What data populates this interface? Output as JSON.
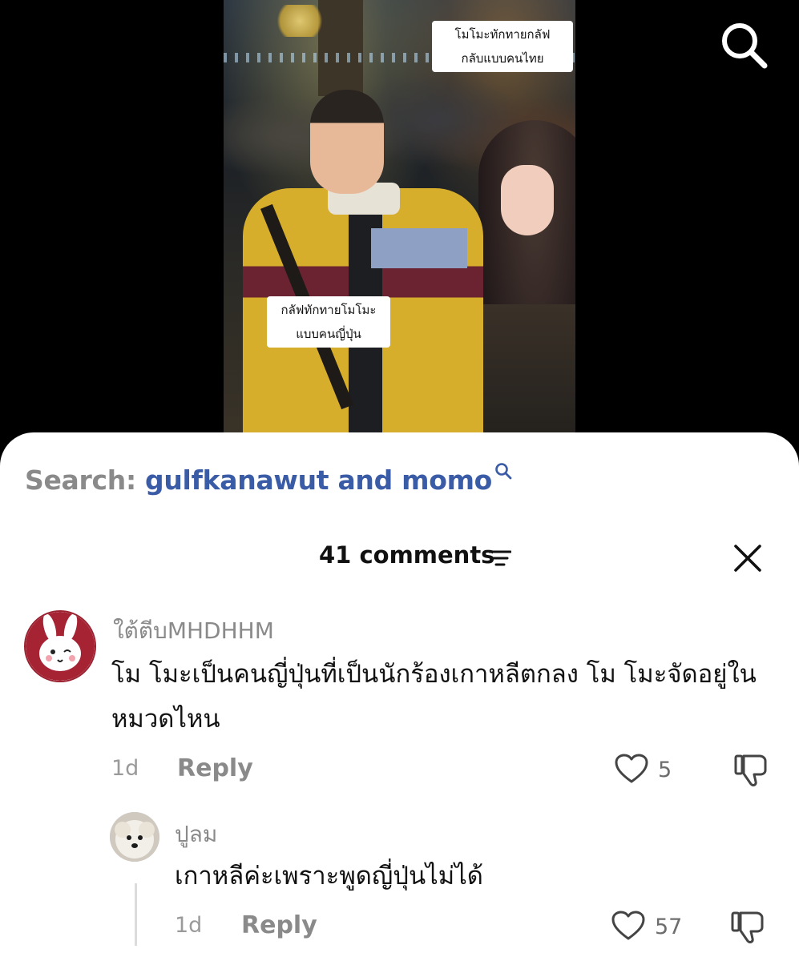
{
  "video": {
    "caption_top": [
      "โมโมะทักทายกลัฟ",
      "กลับแบบคนไทย"
    ],
    "caption_mid": [
      "กลัฟทักทายโมโมะ",
      "แบบคนญี่ปุ่น"
    ]
  },
  "search": {
    "label": "Search: ",
    "query": "gulfkanawut and momo"
  },
  "comments_header": {
    "count_label": "41 comments"
  },
  "comments": [
    {
      "username": "ใต้ตีบMHDHHM",
      "text": "โม โมะเป็นคนญี่ปุ่นที่เป็นนักร้องเกาหลีตกลง โม โมะจัดอยู่ในหมวดไหน",
      "time": "1d",
      "reply_label": "Reply",
      "likes": "5"
    },
    {
      "username": "ปูลม",
      "text": "เกาหลีค่ะเพราะพูดญี่ปุ่นไม่ได้",
      "time": "1d",
      "reply_label": "Reply",
      "likes": "57"
    }
  ],
  "colors": {
    "query": "#3a5ba6",
    "muted": "#8a8a8a",
    "avatar_border": "#9b2231"
  },
  "icons": [
    "search-icon",
    "filter-sort-icon",
    "close-icon",
    "heart-icon",
    "dislike-icon"
  ]
}
